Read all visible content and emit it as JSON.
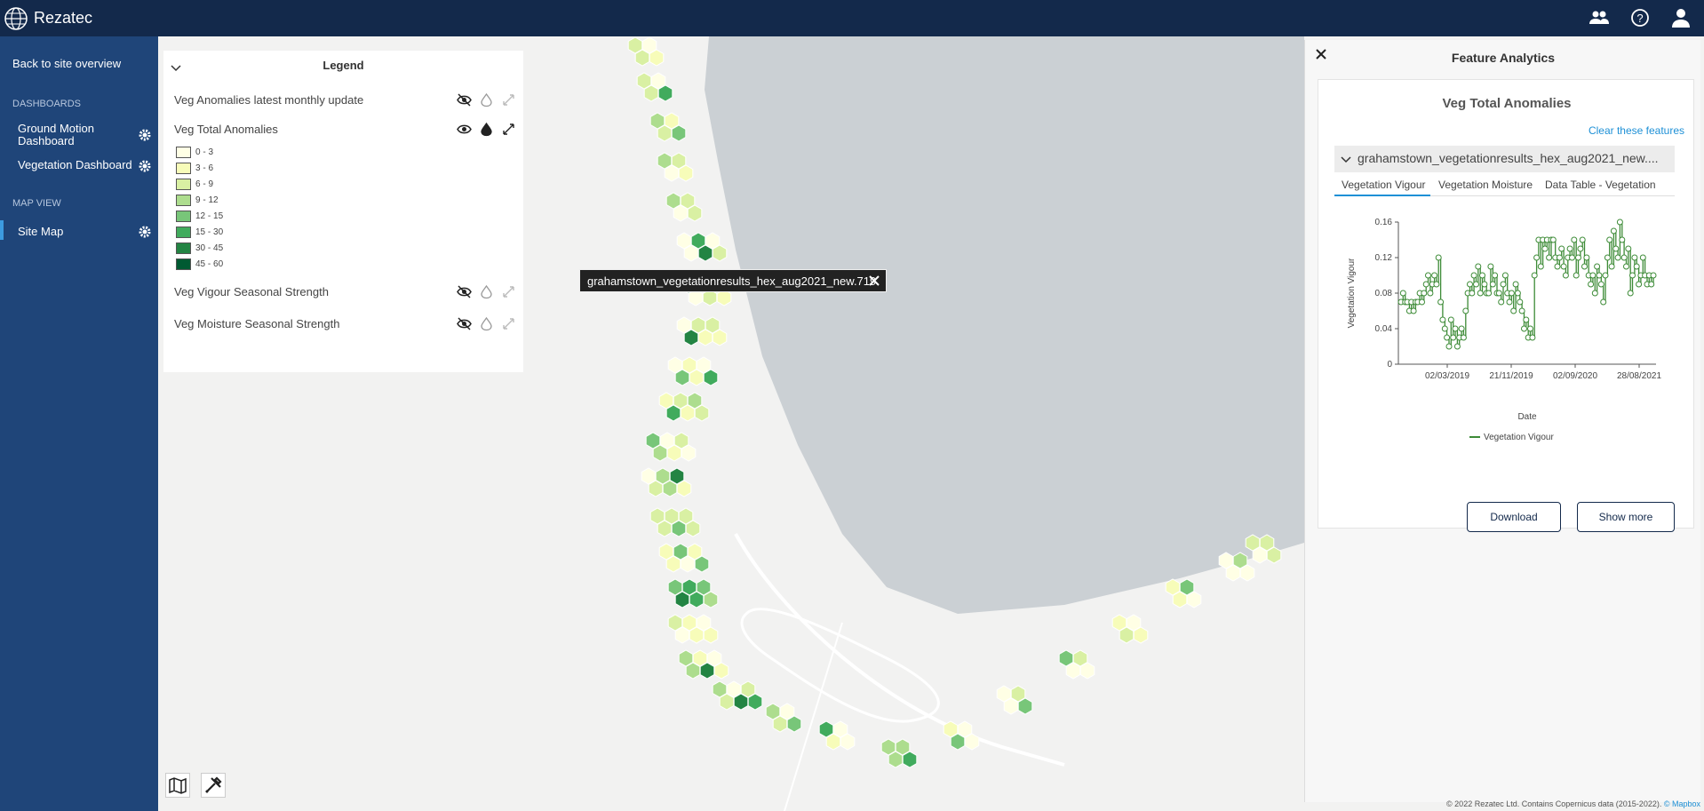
{
  "app": {
    "name": "Rezatec"
  },
  "sidebar": {
    "back_link": "Back to site overview",
    "dashboards_heading": "DASHBOARDS",
    "dashboards": [
      {
        "label": "Ground Motion Dashboard"
      },
      {
        "label": "Vegetation Dashboard"
      }
    ],
    "map_view_heading": "MAP VIEW",
    "map_items": [
      {
        "label": "Site Map"
      }
    ]
  },
  "legend": {
    "title": "Legend",
    "layers": [
      {
        "label": "Veg Anomalies latest monthly update",
        "visible": false
      },
      {
        "label": "Veg Total Anomalies",
        "visible": true
      },
      {
        "label": "Veg Vigour Seasonal Strength",
        "visible": false
      },
      {
        "label": "Veg Moisture Seasonal Strength",
        "visible": false
      }
    ],
    "classes": [
      {
        "label": "0 - 3",
        "color": "#ffffe5"
      },
      {
        "label": "3 - 6",
        "color": "#f7fcb9"
      },
      {
        "label": "6 - 9",
        "color": "#d9f0a3"
      },
      {
        "label": "9 - 12",
        "color": "#addd8e"
      },
      {
        "label": "12 - 15",
        "color": "#78c679"
      },
      {
        "label": "15 - 30",
        "color": "#41ab5d"
      },
      {
        "label": "30 - 45",
        "color": "#238443"
      },
      {
        "label": "45 - 60",
        "color": "#005a32"
      }
    ]
  },
  "map": {
    "tooltip": "grahamstown_vegetationresults_hex_aug2021_new.719",
    "attribution": "© 2022 Rezatec Ltd. Contains Copernicus data (2015-2022).",
    "attribution_link": "© Mapbox"
  },
  "feature_analytics": {
    "title": "Feature Analytics",
    "card_title": "Veg Total Anomalies",
    "clear_link": "Clear these features",
    "feature_name": "grahamstown_vegetationresults_hex_aug2021_new....",
    "tabs": [
      {
        "label": "Vegetation Vigour",
        "active": true
      },
      {
        "label": "Vegetation Moisture"
      },
      {
        "label": "Data Table - Vegetation"
      }
    ],
    "download_label": "Download",
    "show_more_label": "Show more"
  },
  "chart_data": {
    "type": "line",
    "title": "",
    "xlabel": "Date",
    "ylabel": "Vegetation Vigour",
    "ylim": [
      0,
      0.16
    ],
    "yticks": [
      "0",
      "0.04",
      "0.08",
      "0.12",
      "0.16"
    ],
    "xticks": [
      "02/03/2019",
      "21/11/2019",
      "02/09/2020",
      "28/08/2021"
    ],
    "legend": "bottom",
    "color": "#3d8b37",
    "series": [
      {
        "name": "Vegetation Vigour",
        "values": [
          0.07,
          0.08,
          0.07,
          0.07,
          0.06,
          0.07,
          0.06,
          0.07,
          0.07,
          0.08,
          0.07,
          0.08,
          0.09,
          0.1,
          0.08,
          0.09,
          0.1,
          0.09,
          0.12,
          0.07,
          0.05,
          0.04,
          0.03,
          0.02,
          0.05,
          0.03,
          0.04,
          0.02,
          0.03,
          0.04,
          0.03,
          0.06,
          0.08,
          0.09,
          0.08,
          0.1,
          0.09,
          0.11,
          0.08,
          0.1,
          0.09,
          0.08,
          0.08,
          0.11,
          0.09,
          0.1,
          0.08,
          0.08,
          0.07,
          0.09,
          0.1,
          0.08,
          0.07,
          0.08,
          0.06,
          0.09,
          0.08,
          0.07,
          0.06,
          0.04,
          0.05,
          0.03,
          0.04,
          0.03,
          0.1,
          0.12,
          0.14,
          0.11,
          0.14,
          0.13,
          0.14,
          0.12,
          0.14,
          0.14,
          0.12,
          0.11,
          0.12,
          0.13,
          0.11,
          0.1,
          0.12,
          0.13,
          0.12,
          0.14,
          0.1,
          0.12,
          0.13,
          0.14,
          0.11,
          0.12,
          0.1,
          0.09,
          0.1,
          0.08,
          0.11,
          0.1,
          0.09,
          0.07,
          0.1,
          0.12,
          0.14,
          0.11,
          0.15,
          0.13,
          0.12,
          0.16,
          0.14,
          0.12,
          0.11,
          0.13,
          0.08,
          0.1,
          0.12,
          0.11,
          0.09,
          0.1,
          0.12,
          0.1,
          0.09,
          0.1,
          0.09,
          0.1
        ]
      }
    ]
  }
}
